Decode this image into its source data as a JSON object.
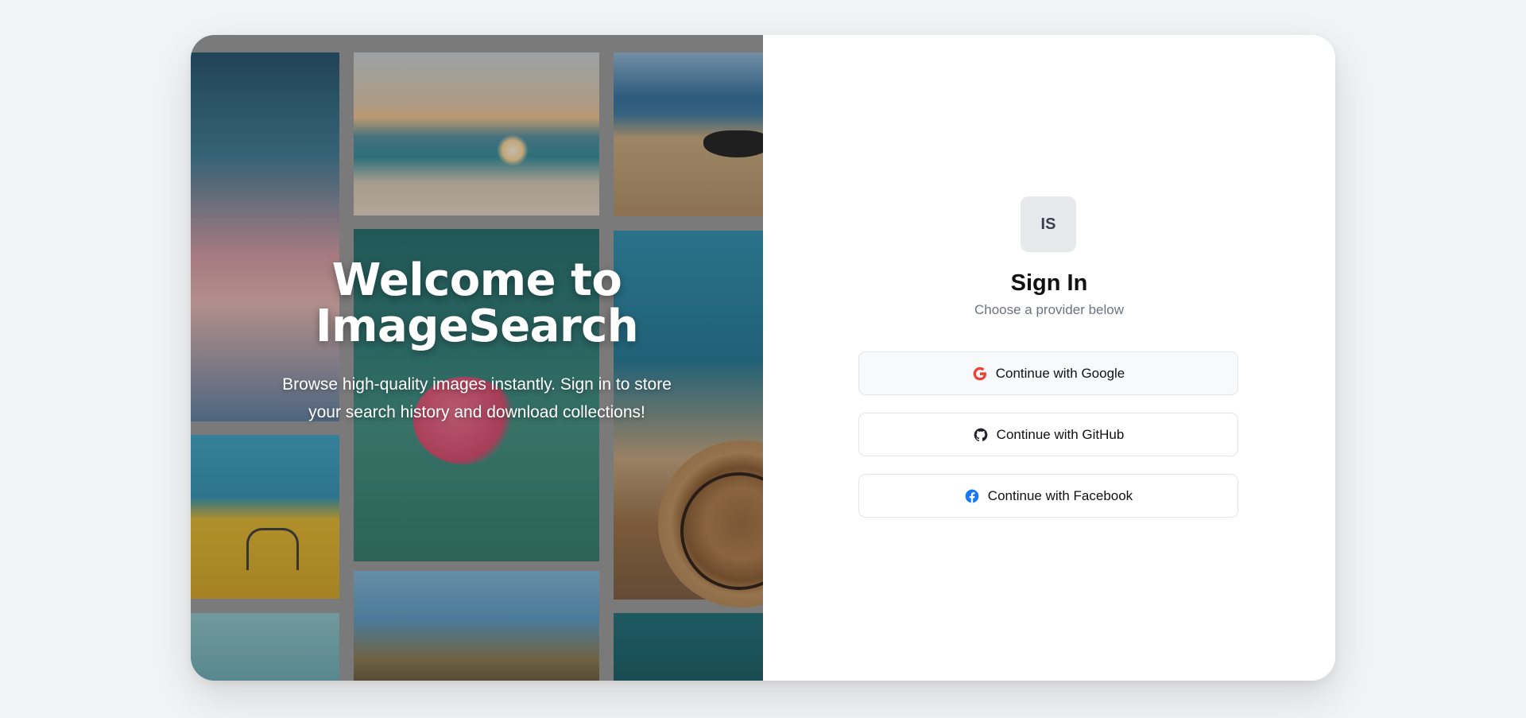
{
  "hero": {
    "title_line1": "Welcome to",
    "title_line2": "ImageSearch",
    "subtitle": "Browse high-quality images instantly. Sign in to store your search history and download collections!"
  },
  "auth": {
    "logo_text": "IS",
    "title": "Sign In",
    "subtitle": "Choose a provider below",
    "providers": [
      {
        "label": "Continue with Google",
        "icon": "google-icon",
        "color": "#EA4335"
      },
      {
        "label": "Continue with GitHub",
        "icon": "github-icon",
        "color": "#1F2328"
      },
      {
        "label": "Continue with Facebook",
        "icon": "facebook-icon",
        "color": "#1877F2"
      }
    ]
  },
  "colors": {
    "page_background": "#f2f3f5",
    "logo_background": "#e8e9ec",
    "subtitle_gray": "#6b7280"
  }
}
